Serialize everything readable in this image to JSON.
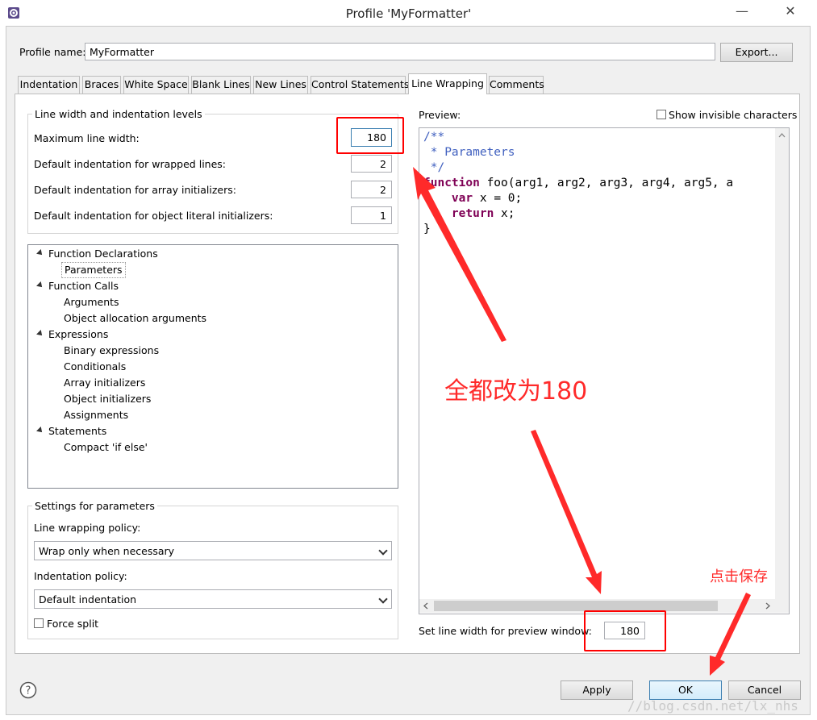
{
  "window": {
    "title": "Profile 'MyFormatter'",
    "min_glyph": "—",
    "close_glyph": "✕"
  },
  "profile": {
    "label": "Profile name:",
    "value": "MyFormatter",
    "export_button": "Export..."
  },
  "tabs": [
    {
      "label": "Indentation"
    },
    {
      "label": "Braces"
    },
    {
      "label": "White Space"
    },
    {
      "label": "Blank Lines"
    },
    {
      "label": "New Lines"
    },
    {
      "label": "Control Statements"
    },
    {
      "label": "Line Wrapping",
      "active": true
    },
    {
      "label": "Comments"
    }
  ],
  "line_width_group": {
    "title": "Line width and indentation levels",
    "fields": [
      {
        "label": "Maximum line width:",
        "value": "180"
      },
      {
        "label": "Default indentation for wrapped lines:",
        "value": "2"
      },
      {
        "label": "Default indentation for array initializers:",
        "value": "2"
      },
      {
        "label": "Default indentation for object literal initializers:",
        "value": "1"
      }
    ]
  },
  "tree": {
    "items": [
      {
        "label": "Function Declarations"
      },
      {
        "label": "Parameters",
        "selected": true
      },
      {
        "label": "Function Calls"
      },
      {
        "label": "Arguments"
      },
      {
        "label": "Object allocation arguments"
      },
      {
        "label": "Expressions"
      },
      {
        "label": "Binary expressions"
      },
      {
        "label": "Conditionals"
      },
      {
        "label": "Array initializers"
      },
      {
        "label": "Object initializers"
      },
      {
        "label": "Assignments"
      },
      {
        "label": "Statements"
      },
      {
        "label": "Compact 'if else'"
      }
    ]
  },
  "settings_group": {
    "title": "Settings for parameters",
    "wrap_policy_label": "Line wrapping policy:",
    "wrap_policy_value": "Wrap only when necessary",
    "indent_policy_label": "Indentation policy:",
    "indent_policy_value": "Default indentation",
    "force_split_label": "Force split"
  },
  "preview": {
    "label": "Preview:",
    "show_invisible_label": "Show invisible characters",
    "code": {
      "c1": "/**",
      "c2": " * Parameters",
      "c3": " */",
      "fn_kw": "function",
      "fn_rest": " foo(arg1, arg2, arg3, arg4, arg5, a",
      "var_kw": "var",
      "var_rest": " x = 0;",
      "ret_kw": "return",
      "ret_rest": " x;",
      "close": "}"
    },
    "line_width_label": "Set line width for preview window:",
    "line_width_value": "180"
  },
  "buttons": {
    "apply": "Apply",
    "ok": "OK",
    "cancel": "Cancel",
    "help": "?"
  },
  "annotations": {
    "change_all": "全都改为180",
    "click_save": "点击保存"
  },
  "watermark": "//blog.csdn.net/lx_nhs",
  "colors": {
    "accent_red": "#ff0000",
    "comment_blue": "#3f5fbf",
    "keyword_purple": "#7f0055"
  }
}
